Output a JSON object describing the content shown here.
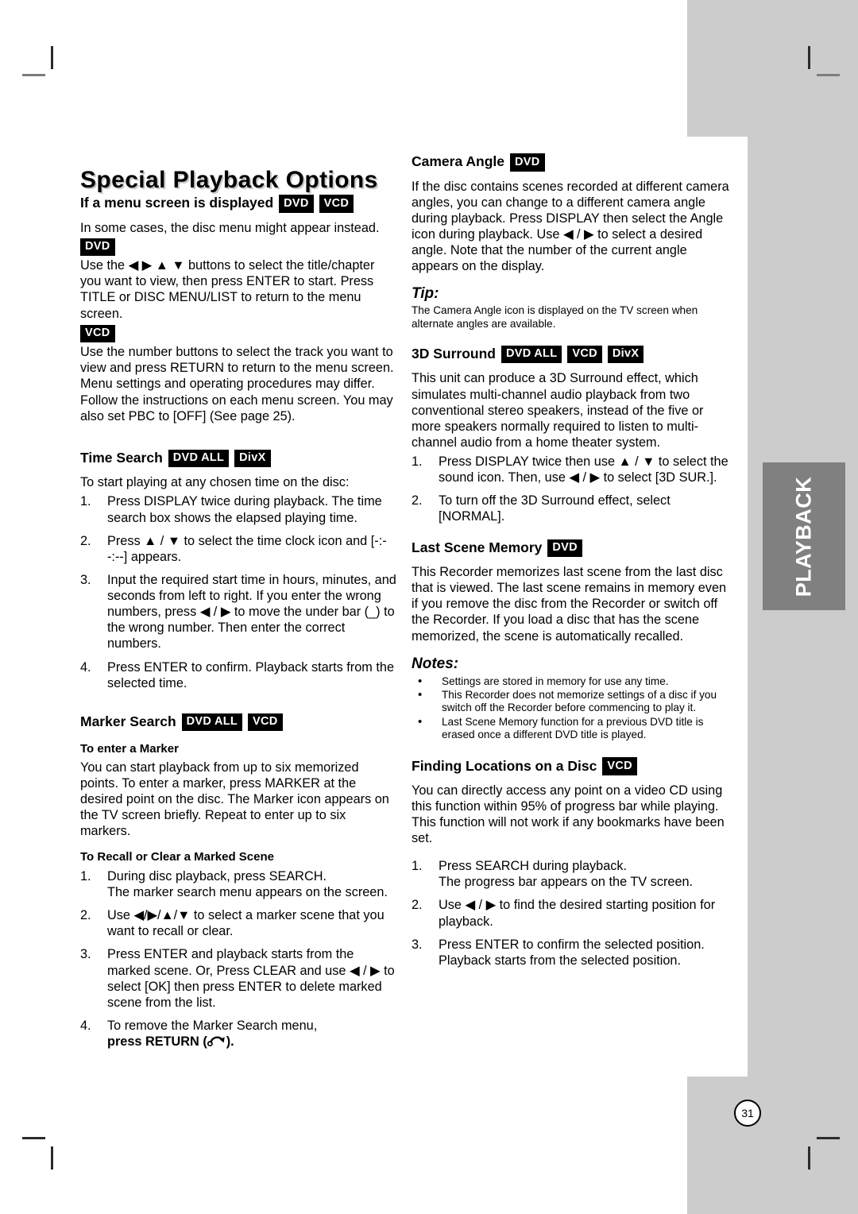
{
  "page": {
    "title": "Special Playback Options",
    "number": "31",
    "side_tab": "PLAYBACK"
  },
  "left_column": {
    "menu_section": {
      "heading": "If a menu screen is displayed",
      "badges": [
        "DVD",
        "VCD"
      ],
      "intro": "In some cases, the disc menu might appear instead.",
      "dvd_badge": "DVD",
      "dvd_text": "Use the ◀ ▶ ▲ ▼ buttons to select the title/chapter you want to view, then press ENTER to start. Press TITLE or DISC MENU/LIST to return to the menu screen.",
      "vcd_badge": "VCD",
      "vcd_text": "Use the number buttons to select the track you want to view and press RETURN to return to the menu screen. Menu settings and operating procedures may differ. Follow the instructions on each menu screen. You may also set PBC to [OFF] (See page 25)."
    },
    "time_search": {
      "heading": "Time Search",
      "badges": [
        "DVD ALL",
        "DivX"
      ],
      "intro": "To start playing at any chosen time on the disc:",
      "steps": [
        {
          "num": "1.",
          "text": "Press DISPLAY twice during playback. The time search box shows the elapsed playing time."
        },
        {
          "num": "2.",
          "text": "Press ▲ / ▼ to select the time clock icon and [-:--:--] appears."
        },
        {
          "num": "3.",
          "text": "Input the required start time in hours, minutes, and seconds from left to right. If you enter the wrong numbers, press ◀ / ▶ to move the under bar (_) to the wrong number. Then enter the correct numbers."
        },
        {
          "num": "4.",
          "text": "Press ENTER to confirm. Playback starts from the selected time."
        }
      ]
    },
    "marker_search": {
      "heading": "Marker Search",
      "badges": [
        "DVD ALL",
        "VCD"
      ],
      "sub_enter": "To enter a Marker",
      "enter_text": "You can start playback from up to six memorized points. To enter a marker, press MARKER at the desired point on the disc. The Marker icon appears on the TV screen briefly. Repeat to enter up to six markers.",
      "sub_recall": "To Recall or Clear a Marked Scene",
      "steps": [
        {
          "num": "1.",
          "text": "During disc playback, press SEARCH.\nThe marker search menu appears on the screen."
        },
        {
          "num": "2.",
          "text": "Use ◀/▶/▲/▼ to select a marker scene that you want to recall or clear."
        },
        {
          "num": "3.",
          "text": "Press ENTER and playback starts from the marked scene. Or, Press CLEAR and use ◀ / ▶ to select [OK] then press ENTER to delete marked scene from the list."
        }
      ],
      "last_step_num": "4.",
      "last_step_line1": "To remove the Marker Search menu,",
      "last_step_line2_prefix": "press RETURN (",
      "last_step_line2_suffix": ")."
    }
  },
  "right_column": {
    "camera_angle": {
      "heading": "Camera Angle",
      "badges": [
        "DVD"
      ],
      "text": "If the disc contains scenes recorded at different camera angles, you can change to a different camera angle during playback. Press DISPLAY then select the Angle icon during playback. Use ◀ / ▶ to select a desired angle. Note that the number of the current angle appears on the display.",
      "tip_label": "Tip:",
      "tip_text": "The Camera Angle icon is displayed on the TV screen when alternate angles are available."
    },
    "surround": {
      "heading": "3D Surround",
      "badges": [
        "DVD ALL",
        "VCD",
        "DivX"
      ],
      "text": "This unit can produce a 3D Surround effect, which simulates multi-channel audio playback from two conventional stereo speakers, instead of the five or more speakers normally required to listen to multi-channel audio from a home theater system.",
      "steps": [
        {
          "num": "1.",
          "text": "Press DISPLAY twice then use ▲ / ▼ to select the sound icon. Then, use ◀ / ▶ to select [3D SUR.]."
        },
        {
          "num": "2.",
          "text": "To turn off the 3D Surround effect, select [NORMAL]."
        }
      ]
    },
    "last_scene": {
      "heading": "Last Scene Memory",
      "badges": [
        "DVD"
      ],
      "text": "This Recorder memorizes last scene from the last disc that is viewed. The last scene remains in memory even if you remove the disc from the Recorder or switch off the Recorder. If you load a disc that has the scene memorized, the scene is automatically recalled.",
      "notes_label": "Notes:",
      "notes": [
        "Settings are stored in memory for use any time.",
        "This Recorder does not memorize settings of a disc if you switch off the Recorder before commencing to play it.",
        "Last Scene Memory function for a previous DVD title is erased once a different DVD title is played."
      ]
    },
    "finding_locations": {
      "heading": "Finding Locations on a Disc",
      "badges": [
        "VCD"
      ],
      "text": "You can directly access any point on a video CD using this function within 95% of progress bar while playing. This function will not work if any bookmarks have been set.",
      "steps": [
        {
          "num": "1.",
          "text": "Press SEARCH during playback.\nThe progress bar appears on the TV screen."
        },
        {
          "num": "2.",
          "text": "Use ◀ / ▶ to find the desired starting position for playback."
        },
        {
          "num": "3.",
          "text": "Press ENTER to confirm the selected position.\nPlayback starts from the selected position."
        }
      ]
    }
  }
}
